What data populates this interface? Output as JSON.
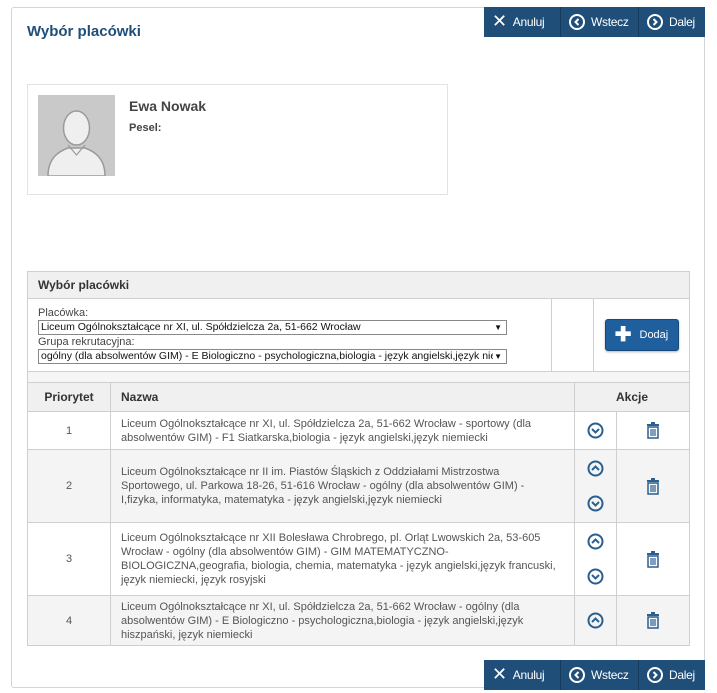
{
  "page": {
    "title": "Wybór placówki"
  },
  "toolbar": {
    "cancel_label": "Anuluj",
    "back_label": "Wstecz",
    "next_label": "Dalej",
    "color": "#1f4e79"
  },
  "profile": {
    "name": "Ewa Nowak",
    "pesel_label": "Pesel:",
    "pesel_value": ""
  },
  "selection": {
    "heading": "Wybór placówki",
    "placowka_label": "Placówka:",
    "placowka_value": "Liceum Ogólnokształcące nr XI, ul. Spółdzielcza 2a, 51-662 Wrocław",
    "grupa_label": "Grupa rekrutacyjna:",
    "grupa_value": "ogólny (dla absolwentów GIM) - E Biologiczno - psychologiczna,biologia - język angielski,język niemiecki",
    "add_label": "Dodaj"
  },
  "table": {
    "headers": {
      "priority": "Priorytet",
      "name": "Nazwa",
      "actions": "Akcje"
    },
    "rows": [
      {
        "priority": "1",
        "name": "Liceum Ogólnokształcące nr XI, ul. Spółdzielcza 2a, 51-662 Wrocław - sportowy (dla absolwentów GIM) - F1 Siatkarska,biologia - język angielski,język niemiecki"
      },
      {
        "priority": "2",
        "name": "Liceum Ogólnokształcące nr II im. Piastów Śląskich z Oddziałami Mistrzostwa Sportowego, ul. Parkowa 18-26, 51-616 Wrocław - ogólny (dla absolwentów GIM) - I,fizyka, informatyka, matematyka - język angielski,język niemiecki"
      },
      {
        "priority": "3",
        "name": "Liceum Ogólnokształcące nr XII Bolesława Chrobrego, pl. Orląt Lwowskich 2a, 53-605 Wrocław - ogólny (dla absolwentów GIM) - GIM MATEMATYCZNO-BIOLOGICZNA,geografia, biologia, chemia, matematyka - język angielski,język francuski, język niemiecki, język rosyjski"
      },
      {
        "priority": "4",
        "name": "Liceum Ogólnokształcące nr XI, ul. Spółdzielcza 2a, 51-662 Wrocław - ogólny (dla absolwentów GIM) - E Biologiczno - psychologiczna,biologia - język angielski,język hiszpański, język niemiecki"
      }
    ]
  },
  "colors": {
    "accent": "#1f4e79",
    "icon": "#2a5f8f"
  }
}
